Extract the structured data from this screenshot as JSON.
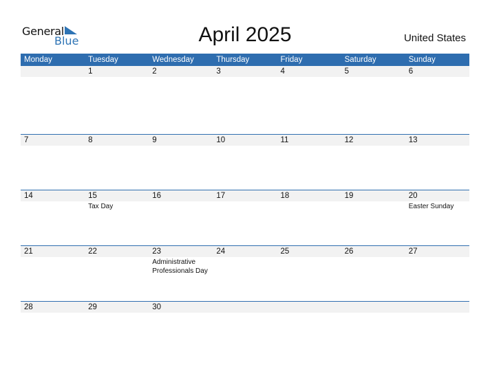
{
  "logo": {
    "line1": "General",
    "line2": "Blue",
    "accent": "#2e74b5"
  },
  "title": "April 2025",
  "country": "United States",
  "header_color": "#2e6daf",
  "days": [
    "Monday",
    "Tuesday",
    "Wednesday",
    "Thursday",
    "Friday",
    "Saturday",
    "Sunday"
  ],
  "weeks": [
    {
      "nums": [
        "",
        "1",
        "2",
        "3",
        "4",
        "5",
        "6"
      ],
      "events": [
        "",
        "",
        "",
        "",
        "",
        "",
        ""
      ]
    },
    {
      "nums": [
        "7",
        "8",
        "9",
        "10",
        "11",
        "12",
        "13"
      ],
      "events": [
        "",
        "",
        "",
        "",
        "",
        "",
        ""
      ]
    },
    {
      "nums": [
        "14",
        "15",
        "16",
        "17",
        "18",
        "19",
        "20"
      ],
      "events": [
        "",
        "Tax Day",
        "",
        "",
        "",
        "",
        "Easter Sunday"
      ]
    },
    {
      "nums": [
        "21",
        "22",
        "23",
        "24",
        "25",
        "26",
        "27"
      ],
      "events": [
        "",
        "",
        "Administrative Professionals Day",
        "",
        "",
        "",
        ""
      ]
    },
    {
      "nums": [
        "28",
        "29",
        "30",
        "",
        "",
        "",
        ""
      ],
      "events": [
        "",
        "",
        "",
        "",
        "",
        "",
        ""
      ]
    }
  ]
}
